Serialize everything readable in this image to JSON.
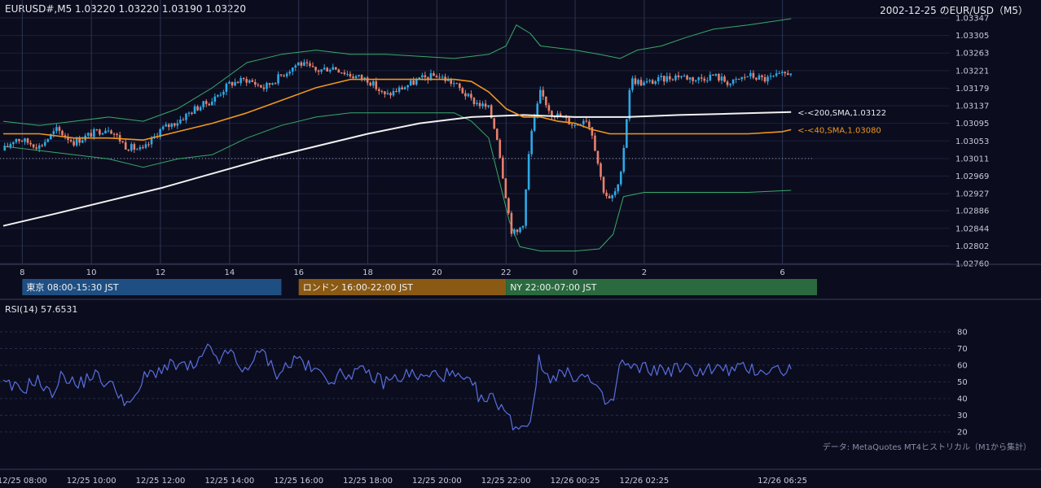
{
  "header": {
    "symbol_ohlc": "EURUSD#,M5 1.03220 1.03220 1.03190 1.03220",
    "right_title": "2002-12-25 のEUR/USD（M5）"
  },
  "rsi_panel": {
    "title": "RSI(14) 57.6531"
  },
  "credit": "データ: MetaQuotes MT4ヒストリカル（M1から集計）",
  "colors": {
    "background": "#0b0d1e",
    "grid": "#1c2038",
    "candle_up": "#2ea8e6",
    "candle_down": "#e8806c",
    "sma200": "#f2f2f2",
    "sma40": "#f0961e",
    "bollinger": "#3aa86a",
    "rsi": "#5a6ee0",
    "tokyo": "#1f4f82",
    "london": "#8a5a14",
    "ny": "#2a6a3e"
  },
  "chart_data": [
    {
      "type": "candlestick",
      "timeframe": "M5",
      "symbol": "EURUSD#",
      "price_levels": [
        "1.03347",
        "1.03305",
        "1.03263",
        "1.03221",
        "1.03179",
        "1.03137",
        "1.03095",
        "1.03053",
        "1.03011",
        "1.02969",
        "1.02927",
        "1.02886",
        "1.02844",
        "1.02802",
        "1.02760"
      ],
      "ylim": [
        1.0276,
        1.03347
      ],
      "hour_ticks": [
        {
          "h": 8,
          "label": "8"
        },
        {
          "h": 10,
          "label": "10"
        },
        {
          "h": 12,
          "label": "12"
        },
        {
          "h": 14,
          "label": "14"
        },
        {
          "h": 16,
          "label": "16"
        },
        {
          "h": 18,
          "label": "18"
        },
        {
          "h": 20,
          "label": "20"
        },
        {
          "h": 22,
          "label": "22"
        },
        {
          "h": 24,
          "label": "0"
        },
        {
          "h": 26,
          "label": "2"
        },
        {
          "h": 30,
          "label": "6"
        }
      ],
      "sessions": [
        {
          "name": "東京 08:00-15:30 JST",
          "start": 8.0,
          "end": 15.5,
          "color_key": "tokyo"
        },
        {
          "name": "ロンドン 16:00-22:00 JST",
          "start": 16.0,
          "end": 22.0,
          "color_key": "london"
        },
        {
          "name": "NY 22:00-07:00 JST",
          "start": 22.0,
          "end": 31.0,
          "color_key": "ny"
        }
      ],
      "labels": {
        "sma200": "<-<200,SMA,1.03122",
        "sma40": "<-<40,SMA,1.03080"
      },
      "last_sma200": 1.03122,
      "last_sma40": 1.0308,
      "dotted_reference": 1.03011,
      "price_path": [
        [
          7.45,
          1.0303
        ],
        [
          7.8,
          1.0306
        ],
        [
          8.5,
          1.0304
        ],
        [
          9.0,
          1.0308
        ],
        [
          9.5,
          1.0305
        ],
        [
          10.0,
          1.0307
        ],
        [
          10.5,
          1.03085
        ],
        [
          11.0,
          1.0304
        ],
        [
          11.5,
          1.0303
        ],
        [
          12.0,
          1.0308
        ],
        [
          12.5,
          1.031
        ],
        [
          13.0,
          1.0313
        ],
        [
          13.5,
          1.0315
        ],
        [
          14.0,
          1.0319
        ],
        [
          14.5,
          1.032
        ],
        [
          15.0,
          1.0318
        ],
        [
          15.5,
          1.0321
        ],
        [
          16.0,
          1.0324
        ],
        [
          16.5,
          1.0322
        ],
        [
          17.0,
          1.0323
        ],
        [
          17.5,
          1.0321
        ],
        [
          18.0,
          1.032
        ],
        [
          18.5,
          1.0316
        ],
        [
          19.0,
          1.0318
        ],
        [
          19.5,
          1.032
        ],
        [
          20.0,
          1.0321
        ],
        [
          20.5,
          1.0319
        ],
        [
          21.0,
          1.0315
        ],
        [
          21.5,
          1.0313
        ],
        [
          21.75,
          1.0306
        ],
        [
          22.0,
          1.0292
        ],
        [
          22.15,
          1.0284
        ],
        [
          22.3,
          1.0283
        ],
        [
          22.5,
          1.0286
        ],
        [
          22.7,
          1.0306
        ],
        [
          23.0,
          1.0317
        ],
        [
          23.3,
          1.0312
        ],
        [
          23.6,
          1.0311
        ],
        [
          24.0,
          1.0309
        ],
        [
          24.3,
          1.0311
        ],
        [
          24.5,
          1.0307
        ],
        [
          24.8,
          1.0294
        ],
        [
          25.0,
          1.0291
        ],
        [
          25.3,
          1.0295
        ],
        [
          25.6,
          1.032
        ],
        [
          26.0,
          1.0319
        ],
        [
          26.5,
          1.032
        ],
        [
          27.0,
          1.0321
        ],
        [
          27.5,
          1.032
        ],
        [
          28.0,
          1.0321
        ],
        [
          28.5,
          1.0319
        ],
        [
          29.0,
          1.0321
        ],
        [
          29.5,
          1.032
        ],
        [
          30.0,
          1.0321
        ],
        [
          30.25,
          1.0322
        ]
      ],
      "sma40_path": [
        [
          7.45,
          1.0307
        ],
        [
          8.5,
          1.0307
        ],
        [
          9.5,
          1.0306
        ],
        [
          10.5,
          1.0306
        ],
        [
          11.5,
          1.03055
        ],
        [
          12.5,
          1.03075
        ],
        [
          13.5,
          1.03095
        ],
        [
          14.5,
          1.0312
        ],
        [
          15.5,
          1.0315
        ],
        [
          16.5,
          1.0318
        ],
        [
          17.5,
          1.032
        ],
        [
          18.5,
          1.032
        ],
        [
          19.5,
          1.032
        ],
        [
          20.5,
          1.032
        ],
        [
          21.0,
          1.03195
        ],
        [
          21.5,
          1.0317
        ],
        [
          22.0,
          1.0313
        ],
        [
          22.5,
          1.0311
        ],
        [
          23.0,
          1.0311
        ],
        [
          23.5,
          1.031
        ],
        [
          24.0,
          1.03095
        ],
        [
          24.5,
          1.0308
        ],
        [
          25.0,
          1.0307
        ],
        [
          26.0,
          1.0307
        ],
        [
          27.0,
          1.0307
        ],
        [
          28.0,
          1.0307
        ],
        [
          29.0,
          1.0307
        ],
        [
          30.0,
          1.03075
        ],
        [
          30.25,
          1.0308
        ]
      ],
      "sma200_path": [
        [
          7.45,
          1.0285
        ],
        [
          9.0,
          1.0288
        ],
        [
          10.5,
          1.0291
        ],
        [
          12.0,
          1.0294
        ],
        [
          13.5,
          1.02975
        ],
        [
          15.0,
          1.0301
        ],
        [
          16.5,
          1.0304
        ],
        [
          18.0,
          1.0307
        ],
        [
          19.5,
          1.03095
        ],
        [
          21.0,
          1.0311
        ],
        [
          22.5,
          1.03115
        ],
        [
          24.0,
          1.0311
        ],
        [
          25.5,
          1.0311
        ],
        [
          27.0,
          1.03115
        ],
        [
          28.5,
          1.03118
        ],
        [
          30.25,
          1.03122
        ]
      ],
      "bb_upper_path": [
        [
          7.45,
          1.031
        ],
        [
          8.5,
          1.0309
        ],
        [
          9.5,
          1.031
        ],
        [
          10.5,
          1.0311
        ],
        [
          11.5,
          1.031
        ],
        [
          12.5,
          1.0313
        ],
        [
          13.5,
          1.0318
        ],
        [
          14.5,
          1.0324
        ],
        [
          15.5,
          1.0326
        ],
        [
          16.5,
          1.0327
        ],
        [
          17.5,
          1.0326
        ],
        [
          18.5,
          1.0326
        ],
        [
          19.5,
          1.03255
        ],
        [
          20.5,
          1.0325
        ],
        [
          21.5,
          1.0326
        ],
        [
          22.0,
          1.0328
        ],
        [
          22.3,
          1.0333
        ],
        [
          22.7,
          1.0331
        ],
        [
          23.0,
          1.0328
        ],
        [
          24.0,
          1.0327
        ],
        [
          24.7,
          1.0326
        ],
        [
          25.3,
          1.0325
        ],
        [
          25.8,
          1.0327
        ],
        [
          26.5,
          1.0328
        ],
        [
          27.2,
          1.033
        ],
        [
          28.0,
          1.0332
        ],
        [
          29.0,
          1.0333
        ],
        [
          30.25,
          1.03345
        ]
      ],
      "bb_lower_path": [
        [
          7.45,
          1.0304
        ],
        [
          8.5,
          1.0303
        ],
        [
          9.5,
          1.0302
        ],
        [
          10.5,
          1.0301
        ],
        [
          11.5,
          1.0299
        ],
        [
          12.5,
          1.0301
        ],
        [
          13.5,
          1.0302
        ],
        [
          14.5,
          1.0306
        ],
        [
          15.5,
          1.0309
        ],
        [
          16.5,
          1.0311
        ],
        [
          17.5,
          1.0312
        ],
        [
          18.5,
          1.0312
        ],
        [
          19.5,
          1.0312
        ],
        [
          20.5,
          1.0312
        ],
        [
          21.0,
          1.031
        ],
        [
          21.5,
          1.0306
        ],
        [
          21.8,
          1.0296
        ],
        [
          22.1,
          1.0286
        ],
        [
          22.4,
          1.028
        ],
        [
          23.0,
          1.0279
        ],
        [
          24.0,
          1.0279
        ],
        [
          24.7,
          1.02795
        ],
        [
          25.1,
          1.0283
        ],
        [
          25.4,
          1.0292
        ],
        [
          26.0,
          1.0293
        ],
        [
          27.0,
          1.0293
        ],
        [
          28.0,
          1.0293
        ],
        [
          29.0,
          1.0293
        ],
        [
          30.25,
          1.02935
        ]
      ]
    },
    {
      "type": "line",
      "name": "RSI(14)",
      "last": 57.6531,
      "ylim": [
        20,
        80
      ],
      "ticks": [
        20,
        30,
        40,
        50,
        60,
        70,
        80
      ],
      "series": [
        [
          7.45,
          48
        ],
        [
          8.0,
          45
        ],
        [
          8.4,
          52
        ],
        [
          8.8,
          42
        ],
        [
          9.2,
          55
        ],
        [
          9.6,
          47
        ],
        [
          10.0,
          55
        ],
        [
          10.4,
          50
        ],
        [
          10.8,
          44
        ],
        [
          11.0,
          38
        ],
        [
          11.2,
          36
        ],
        [
          11.5,
          52
        ],
        [
          12.0,
          58
        ],
        [
          12.5,
          60
        ],
        [
          13.0,
          58
        ],
        [
          13.4,
          70
        ],
        [
          13.8,
          62
        ],
        [
          14.0,
          71
        ],
        [
          14.3,
          55
        ],
        [
          14.6,
          62
        ],
        [
          15.0,
          68
        ],
        [
          15.3,
          55
        ],
        [
          15.7,
          60
        ],
        [
          16.0,
          65
        ],
        [
          16.3,
          58
        ],
        [
          16.6,
          55
        ],
        [
          17.0,
          52
        ],
        [
          17.5,
          56
        ],
        [
          18.0,
          55
        ],
        [
          18.4,
          50
        ],
        [
          18.8,
          52
        ],
        [
          19.2,
          55
        ],
        [
          19.6,
          52
        ],
        [
          20.0,
          55
        ],
        [
          20.4,
          54
        ],
        [
          20.8,
          50
        ],
        [
          21.1,
          46
        ],
        [
          21.3,
          38
        ],
        [
          21.6,
          40
        ],
        [
          21.9,
          36
        ],
        [
          22.0,
          30
        ],
        [
          22.2,
          25
        ],
        [
          22.45,
          23
        ],
        [
          22.7,
          27
        ],
        [
          22.95,
          62
        ],
        [
          23.2,
          53
        ],
        [
          23.5,
          55
        ],
        [
          23.8,
          54
        ],
        [
          24.1,
          54
        ],
        [
          24.4,
          52
        ],
        [
          24.6,
          45
        ],
        [
          24.85,
          38
        ],
        [
          25.1,
          37
        ],
        [
          25.3,
          62
        ],
        [
          25.6,
          58
        ],
        [
          26.0,
          58
        ],
        [
          26.5,
          57
        ],
        [
          27.0,
          58
        ],
        [
          27.5,
          57
        ],
        [
          28.0,
          58
        ],
        [
          28.5,
          57
        ],
        [
          29.0,
          58
        ],
        [
          29.5,
          57
        ],
        [
          30.25,
          57.65
        ]
      ],
      "time_labels": [
        {
          "h": 8,
          "label": "12/25 08:00"
        },
        {
          "h": 10,
          "label": "12/25 10:00"
        },
        {
          "h": 12,
          "label": "12/25 12:00"
        },
        {
          "h": 14,
          "label": "12/25 14:00"
        },
        {
          "h": 16,
          "label": "12/25 16:00"
        },
        {
          "h": 18,
          "label": "12/25 18:00"
        },
        {
          "h": 20,
          "label": "12/25 20:00"
        },
        {
          "h": 22,
          "label": "12/25 22:00"
        },
        {
          "h": 24,
          "label": "12/26 00:25"
        },
        {
          "h": 26,
          "label": "12/26 02:25"
        },
        {
          "h": 30,
          "label": "12/26 06:25"
        }
      ]
    }
  ]
}
